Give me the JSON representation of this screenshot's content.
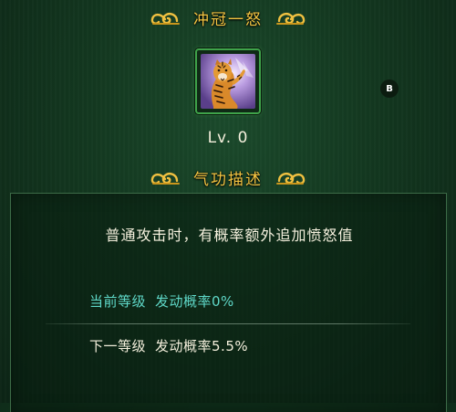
{
  "skill": {
    "name": "冲冠一怒",
    "level": "Lv. 0",
    "icon": "tiger-skill-icon"
  },
  "section": {
    "title": "气功描述"
  },
  "badge": {
    "label": "B"
  },
  "description": {
    "effect": "普通攻击时，有概率额外追加愤怒值",
    "current": {
      "label": "当前等级",
      "value": "发动概率0%"
    },
    "next": {
      "label": "下一等级",
      "value": "发动概率5.5%"
    }
  },
  "colors": {
    "title_gold": "#f4c542",
    "current_teal": "#5fd8c8",
    "frame_green": "#3fa34a"
  }
}
